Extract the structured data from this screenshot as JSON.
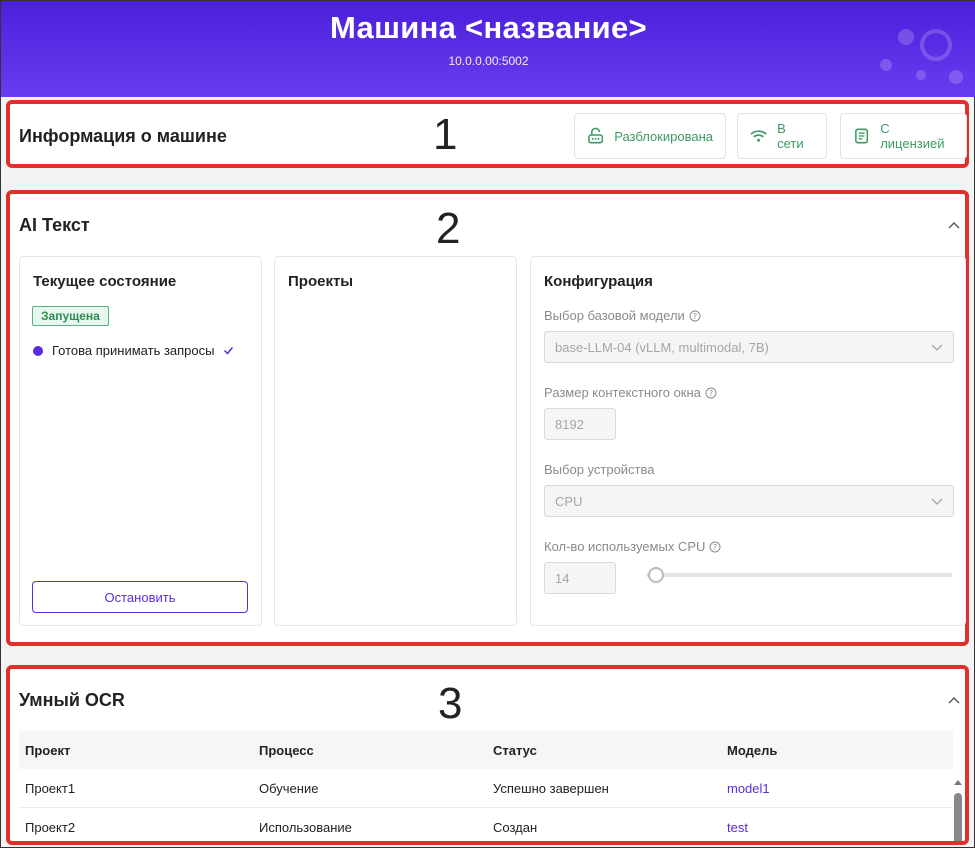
{
  "header": {
    "title": "Машина <название>",
    "address": "10.0.0.00:5002"
  },
  "markers": [
    "1",
    "2",
    "3"
  ],
  "machine_info": {
    "title": "Информация о машине",
    "badges": [
      {
        "label": "Разблокирована",
        "icon": "unlock-icon"
      },
      {
        "label": "В сети",
        "icon": "wifi-icon"
      },
      {
        "label": "С лицензией",
        "icon": "license-icon"
      }
    ],
    "badge_color": "#3d9a63"
  },
  "ai_text": {
    "title": "AI Текст",
    "state_card": {
      "title": "Текущее состояние",
      "status": "Запущена",
      "ready_text": "Готова принимать запросы",
      "stop_label": "Остановить"
    },
    "projects_card": {
      "title": "Проекты"
    },
    "config_card": {
      "title": "Конфигурация",
      "base_model_label": "Выбор базовой модели",
      "base_model_value": "base-LLM-04 (vLLM, multimodal, 7B)",
      "context_label": "Размер контекстного окна",
      "context_value": "8192",
      "device_label": "Выбор устройства",
      "device_value": "CPU",
      "cpu_count_label": "Кол-во используемых CPU",
      "cpu_count_value": "14"
    }
  },
  "smart_ocr": {
    "title": "Умный OCR",
    "columns": [
      "Проект",
      "Процесс",
      "Статус",
      "Модель"
    ],
    "rows": [
      [
        "Проект1",
        "Обучение",
        "Успешно завершен",
        "model1"
      ],
      [
        "Проект2",
        "Использование",
        "Создан",
        "test"
      ]
    ]
  },
  "colors": {
    "accent": "#5b2be0",
    "highlight_border": "#e0302a",
    "header_gradient": "#4a1fd8"
  }
}
